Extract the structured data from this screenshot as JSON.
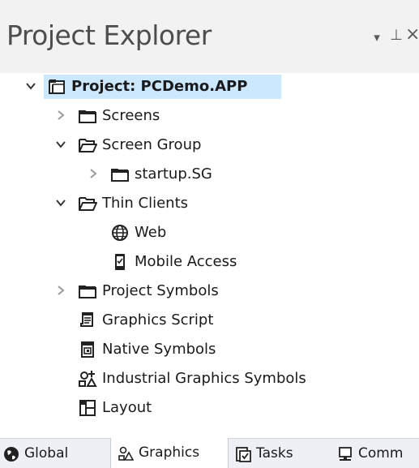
{
  "panel": {
    "title": "Project Explorer",
    "buttons": {
      "dropdown": "▾",
      "pin": "⊥",
      "close": "×"
    }
  },
  "tree": {
    "root": {
      "label": "Project: PCDemo.APP",
      "expanded": true,
      "selected": true
    },
    "items": [
      {
        "label": "Screens",
        "icon": "folder-icon",
        "expander": "collapsed"
      },
      {
        "label": "Screen Group",
        "icon": "open-folder-icon",
        "expander": "expanded"
      },
      {
        "label": "startup.SG",
        "icon": "folder-icon",
        "expander": "collapsed"
      },
      {
        "label": "Thin Clients",
        "icon": "open-folder-icon",
        "expander": "expanded"
      },
      {
        "label": "Web",
        "icon": "globe-icon",
        "expander": "none"
      },
      {
        "label": "Mobile Access",
        "icon": "mobile-icon",
        "expander": "none"
      },
      {
        "label": "Project Symbols",
        "icon": "folder-icon",
        "expander": "collapsed"
      },
      {
        "label": "Graphics Script",
        "icon": "script-icon",
        "expander": "none"
      },
      {
        "label": "Native Symbols",
        "icon": "native-symbol-icon",
        "expander": "none"
      },
      {
        "label": "Industrial Graphics Symbols",
        "icon": "industrial-graphics-icon",
        "expander": "none"
      },
      {
        "label": "Layout",
        "icon": "layout-icon",
        "expander": "none"
      }
    ]
  },
  "tabs": [
    {
      "label": "Global",
      "icon": "globe-icon",
      "active": false
    },
    {
      "label": "Graphics",
      "icon": "graphics-icon",
      "active": true
    },
    {
      "label": "Tasks",
      "icon": "tasks-icon",
      "active": false
    },
    {
      "label": "Comm",
      "icon": "comm-icon",
      "active": false
    }
  ],
  "colors": {
    "selection": "#cce8ff",
    "title_bar": "#f2f2f2",
    "tab_bar": "#eef0f5"
  }
}
